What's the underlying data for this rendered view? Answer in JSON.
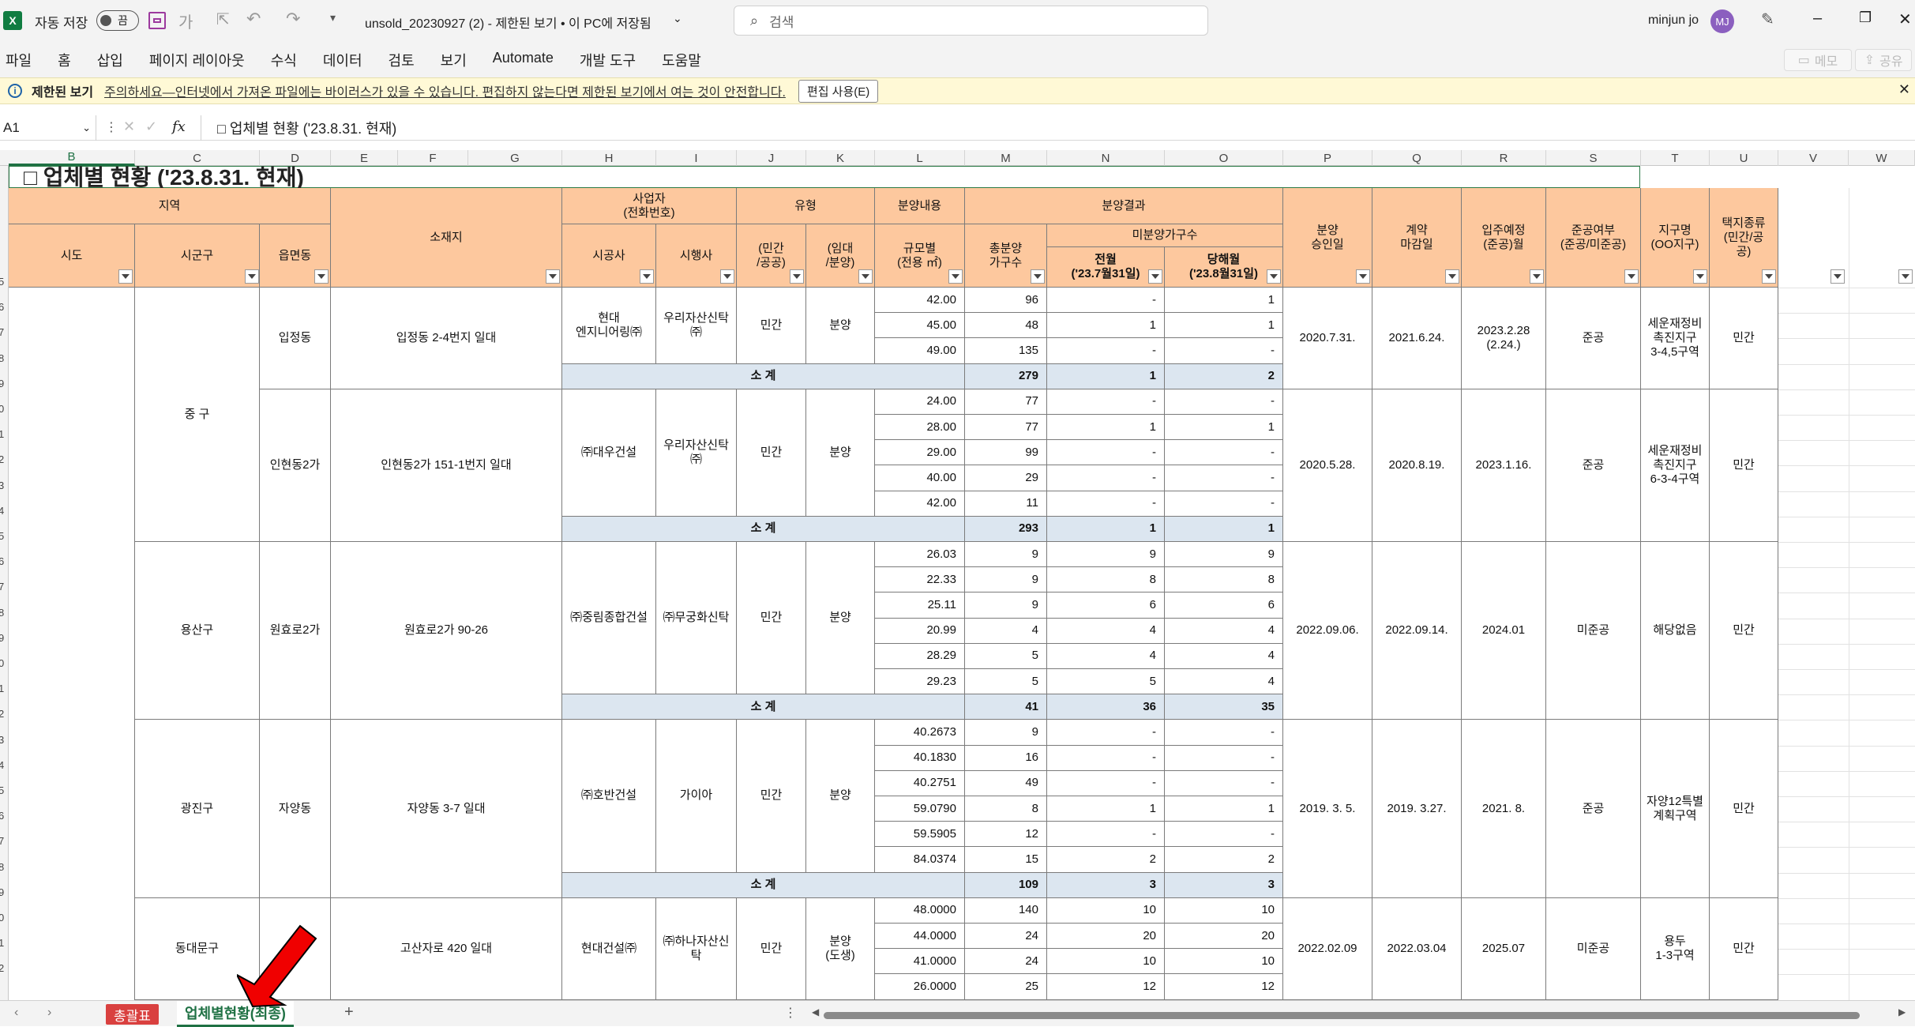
{
  "titlebar": {
    "autosave_label": "자동 저장",
    "autosave_state": "끔",
    "file_title": "unsold_20230927 (2)  -  제한된 보기 • 이 PC에 저장됨",
    "search_placeholder": "검색",
    "user_name": "minjun jo",
    "user_initials": "MJ"
  },
  "menu": {
    "items": [
      "파일",
      "홈",
      "삽입",
      "페이지 레이아웃",
      "수식",
      "데이터",
      "검토",
      "보기",
      "Automate",
      "개발 도구",
      "도움말"
    ],
    "memo": "메모",
    "share": "공유"
  },
  "infobar": {
    "title": "제한된 보기",
    "message": "주의하세요—인터넷에서 가져온 파일에는 바이러스가 있을 수 있습니다. 편집하지 않는다면 제한된 보기에서 여는 것이 안전합니다.",
    "button": "편집 사용(E)"
  },
  "formula": {
    "name_box": "A1",
    "fx": "fx",
    "content": "□ 업체별 현황 ('23.8.31. 현재)"
  },
  "columns": [
    "B",
    "C",
    "D",
    "E",
    "F",
    "G",
    "H",
    "I",
    "J",
    "K",
    "L",
    "M",
    "N",
    "O",
    "P",
    "Q",
    "R",
    "S",
    "T",
    "U",
    "V",
    "W"
  ],
  "rows": [
    "5",
    "6",
    "7",
    "8",
    "9",
    "0",
    "1",
    "2",
    "3",
    "4",
    "5",
    "6",
    "7",
    "8",
    "9",
    "0",
    "1",
    "2",
    "3",
    "4",
    "5",
    "6",
    "7",
    "8",
    "9",
    "0",
    "1",
    "2"
  ],
  "sheet": {
    "title": "□ 업체별 현황 ('23.8.31. 현재)",
    "headers": {
      "region": "지역",
      "sido": "시도",
      "sigungu": "시군구",
      "eupmyeon": "읍면동",
      "address": "소재지",
      "operator": "사업자\n(전화번호)",
      "builder": "시공사",
      "developer": "시행사",
      "type": "유형",
      "type_a": "(민간\n/공공)",
      "type_b": "(임대\n/분양)",
      "sale_content": "분양내용",
      "size": "규모별\n(전용 ㎡)",
      "sale_result": "분양결과",
      "total_units": "총분양\n가구수",
      "unsold": "미분양가구수",
      "prev_month": "전월\n('23.7월31일)",
      "this_month": "당해월\n('23.8월31일)",
      "approval": "분양\n승인일",
      "contract": "계약\n마감일",
      "move_in": "입주예정\n(준공)월",
      "completed": "준공여부\n(준공/미준공)",
      "district": "지구명\n(OO지구)",
      "land": "택지종류\n(민간/공\n공)"
    },
    "subtotal_label": "소  계",
    "groups": [
      {
        "sigungu": "중  구",
        "dong": "입정동",
        "address": "입정동 2-4번지 일대",
        "builder": "현대\n엔지니어링㈜",
        "developer": "우리자산신탁\n㈜",
        "type_a": "민간",
        "type_b": "분양",
        "approval": "2020.7.31.",
        "contract": "2021.6.24.",
        "move_in": "2023.2.28\n(2.24.)",
        "completed": "준공",
        "district": "세운재정비\n촉진지구\n3-4,5구역",
        "land": "민간",
        "rows": [
          {
            "size": "42.00",
            "total": "96",
            "prev": "-",
            "cur": "1"
          },
          {
            "size": "45.00",
            "total": "48",
            "prev": "1",
            "cur": "1"
          },
          {
            "size": "49.00",
            "total": "135",
            "prev": "-",
            "cur": "-"
          }
        ],
        "subtotal": {
          "total": "279",
          "prev": "1",
          "cur": "2"
        }
      },
      {
        "sigungu": "",
        "dong": "인현동2가",
        "address": "인현동2가 151-1번지 일대",
        "builder": "㈜대우건설",
        "developer": "우리자산신탁\n㈜",
        "type_a": "민간",
        "type_b": "분양",
        "approval": "2020.5.28.",
        "contract": "2020.8.19.",
        "move_in": "2023.1.16.",
        "completed": "준공",
        "district": "세운재정비\n촉진지구\n6-3-4구역",
        "land": "민간",
        "rows": [
          {
            "size": "24.00",
            "total": "77",
            "prev": "-",
            "cur": "-"
          },
          {
            "size": "28.00",
            "total": "77",
            "prev": "1",
            "cur": "1"
          },
          {
            "size": "29.00",
            "total": "99",
            "prev": "-",
            "cur": "-"
          },
          {
            "size": "40.00",
            "total": "29",
            "prev": "-",
            "cur": "-"
          },
          {
            "size": "42.00",
            "total": "11",
            "prev": "-",
            "cur": "-"
          }
        ],
        "subtotal": {
          "total": "293",
          "prev": "1",
          "cur": "1"
        }
      },
      {
        "sigungu": "용산구",
        "dong": "원효로2가",
        "address": "원효로2가 90-26",
        "builder": "㈜중림종합건설",
        "developer": "㈜무궁화신탁",
        "type_a": "민간",
        "type_b": "분양",
        "approval": "2022.09.06.",
        "contract": "2022.09.14.",
        "move_in": "2024.01",
        "completed": "미준공",
        "district": "해당없음",
        "land": "민간",
        "rows": [
          {
            "size": "26.03",
            "total": "9",
            "prev": "9",
            "cur": "9"
          },
          {
            "size": "22.33",
            "total": "9",
            "prev": "8",
            "cur": "8"
          },
          {
            "size": "25.11",
            "total": "9",
            "prev": "6",
            "cur": "6"
          },
          {
            "size": "20.99",
            "total": "4",
            "prev": "4",
            "cur": "4"
          },
          {
            "size": "28.29",
            "total": "5",
            "prev": "4",
            "cur": "4"
          },
          {
            "size": "29.23",
            "total": "5",
            "prev": "5",
            "cur": "4"
          }
        ],
        "subtotal": {
          "total": "41",
          "prev": "36",
          "cur": "35"
        }
      },
      {
        "sigungu": "광진구",
        "dong": "자양동",
        "address": "자양동 3-7 일대",
        "builder": "㈜호반건설",
        "developer": "가이아",
        "type_a": "민간",
        "type_b": "분양",
        "approval": "2019. 3. 5.",
        "contract": "2019. 3.27.",
        "move_in": "2021. 8.",
        "completed": "준공",
        "district": "자양12특별\n계획구역",
        "land": "민간",
        "rows": [
          {
            "size": "40.2673",
            "total": "9",
            "prev": "-",
            "cur": "-"
          },
          {
            "size": "40.1830",
            "total": "16",
            "prev": "-",
            "cur": "-"
          },
          {
            "size": "40.2751",
            "total": "49",
            "prev": "-",
            "cur": "-"
          },
          {
            "size": "59.0790",
            "total": "8",
            "prev": "1",
            "cur": "1"
          },
          {
            "size": "59.5905",
            "total": "12",
            "prev": "-",
            "cur": "-"
          },
          {
            "size": "84.0374",
            "total": "15",
            "prev": "2",
            "cur": "2"
          }
        ],
        "subtotal": {
          "total": "109",
          "prev": "3",
          "cur": "3"
        }
      },
      {
        "sigungu": "동대문구",
        "dong": "용",
        "address": "고산자로 420 일대",
        "builder": "현대건설㈜",
        "developer": "㈜하나자산신\n탁",
        "type_a": "민간",
        "type_b": "분양\n(도생)",
        "approval": "2022.02.09",
        "contract": "2022.03.04",
        "move_in": "2025.07",
        "completed": "미준공",
        "district": "용두\n1-3구역",
        "land": "민간",
        "rows": [
          {
            "size": "48.0000",
            "total": "140",
            "prev": "10",
            "cur": "10"
          },
          {
            "size": "44.0000",
            "total": "24",
            "prev": "20",
            "cur": "20"
          },
          {
            "size": "41.0000",
            "total": "24",
            "prev": "10",
            "cur": "10"
          },
          {
            "size": "26.0000",
            "total": "25",
            "prev": "12",
            "cur": "12"
          }
        ],
        "subtotal": null
      }
    ]
  },
  "tabs": {
    "items": [
      "총괄표",
      "업체별현황(최종)"
    ],
    "active": 1,
    "add": "+"
  }
}
